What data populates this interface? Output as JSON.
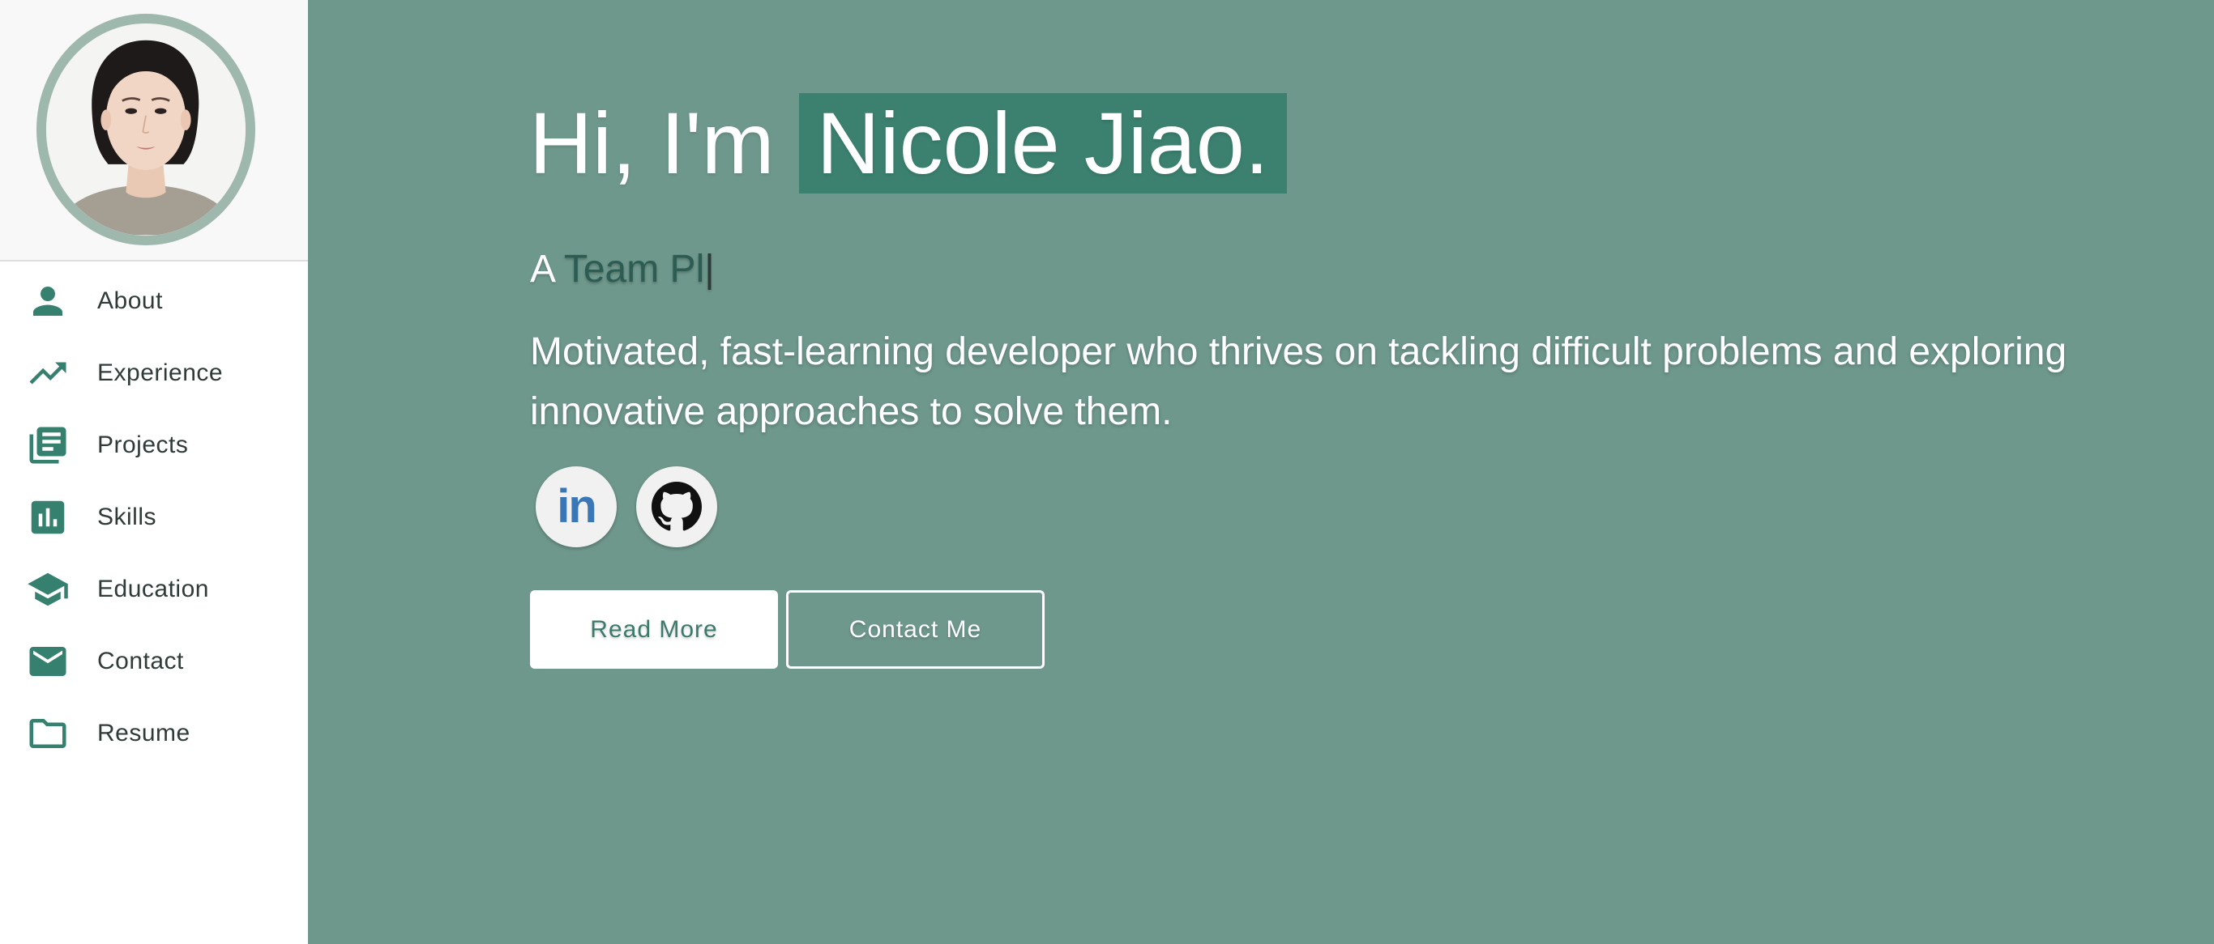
{
  "sidebar": {
    "avatar_alt": "Nicole Jiao",
    "items": [
      {
        "label": "About",
        "icon": "person-icon"
      },
      {
        "label": "Experience",
        "icon": "trending-up-icon"
      },
      {
        "label": "Projects",
        "icon": "library-books-icon"
      },
      {
        "label": "Skills",
        "icon": "bar-chart-icon"
      },
      {
        "label": "Education",
        "icon": "graduation-cap-icon"
      },
      {
        "label": "Contact",
        "icon": "mail-icon"
      },
      {
        "label": "Resume",
        "icon": "folder-icon"
      }
    ]
  },
  "hero": {
    "greeting_prefix": "Hi, I'm",
    "name": "Nicole Jiao.",
    "typing_prefix": "A",
    "typing_text": "Team Pl",
    "typing_cursor": "|",
    "bio": "Motivated, fast-learning developer who thrives on tackling difficult problems and exploring innovative approaches to solve them.",
    "social": [
      {
        "name": "linkedin",
        "label": "in",
        "icon": "linkedin-icon"
      },
      {
        "name": "github",
        "icon": "github-icon"
      }
    ],
    "buttons": {
      "read_more": "Read More",
      "contact_me": "Contact Me"
    }
  },
  "colors": {
    "accent": "#36806f",
    "main_background": "#6f988c",
    "name_highlight": "#3c8170",
    "avatar_border": "#9fb8ae",
    "linkedin_blue": "#3a77b7"
  }
}
